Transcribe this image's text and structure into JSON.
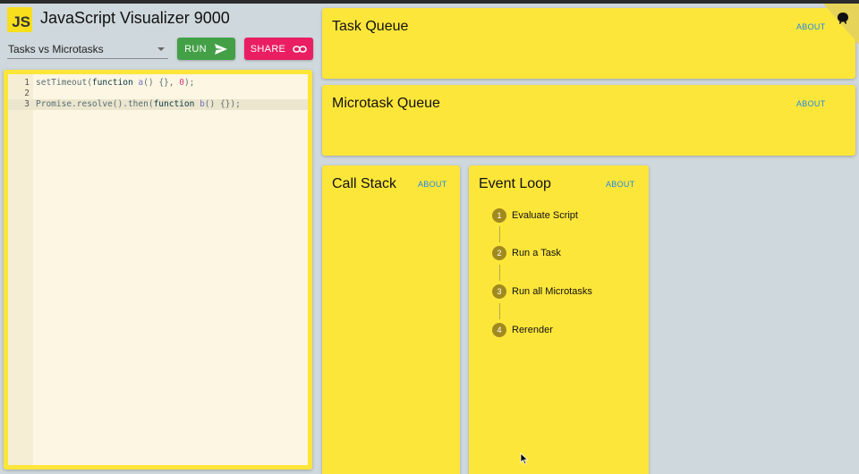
{
  "app": {
    "logo_text": "JS",
    "title": "JavaScript Visualizer 9000"
  },
  "toolbar": {
    "example_selected": "Tasks vs Microtasks",
    "run_label": "RUN",
    "share_label": "SHARE"
  },
  "editor": {
    "lines": [
      {
        "number": "1",
        "tokens": [
          {
            "t": "setTimeout(",
            "c": ""
          },
          {
            "t": "function",
            "c": "kw"
          },
          {
            "t": " ",
            "c": ""
          },
          {
            "t": "a",
            "c": "fn"
          },
          {
            "t": "() {}, ",
            "c": ""
          },
          {
            "t": "0",
            "c": "num"
          },
          {
            "t": ");",
            "c": ""
          }
        ]
      },
      {
        "number": "2",
        "tokens": []
      },
      {
        "number": "3",
        "tokens": [
          {
            "t": "Promise.resolve().then(",
            "c": ""
          },
          {
            "t": "function",
            "c": "kw"
          },
          {
            "t": " ",
            "c": ""
          },
          {
            "t": "b",
            "c": "fn"
          },
          {
            "t": "() {});",
            "c": ""
          }
        ]
      }
    ]
  },
  "panels": {
    "task_queue": {
      "title": "Task Queue",
      "about": "ABOUT"
    },
    "microtask_queue": {
      "title": "Microtask Queue",
      "about": "ABOUT"
    },
    "call_stack": {
      "title": "Call Stack",
      "about": "ABOUT"
    },
    "event_loop": {
      "title": "Event Loop",
      "about": "ABOUT",
      "steps": [
        {
          "n": "1",
          "label": "Evaluate Script"
        },
        {
          "n": "2",
          "label": "Run a Task"
        },
        {
          "n": "3",
          "label": "Run all Microtasks"
        },
        {
          "n": "4",
          "label": "Rerender"
        }
      ]
    }
  },
  "icons": {
    "run": "send-icon",
    "share": "link-icon",
    "corner": "github-octocat-icon"
  },
  "colors": {
    "panel": "#fde63a",
    "run": "#43a047",
    "share": "#e91e63",
    "link": "#1e88e5",
    "background": "#cfd8dc"
  }
}
